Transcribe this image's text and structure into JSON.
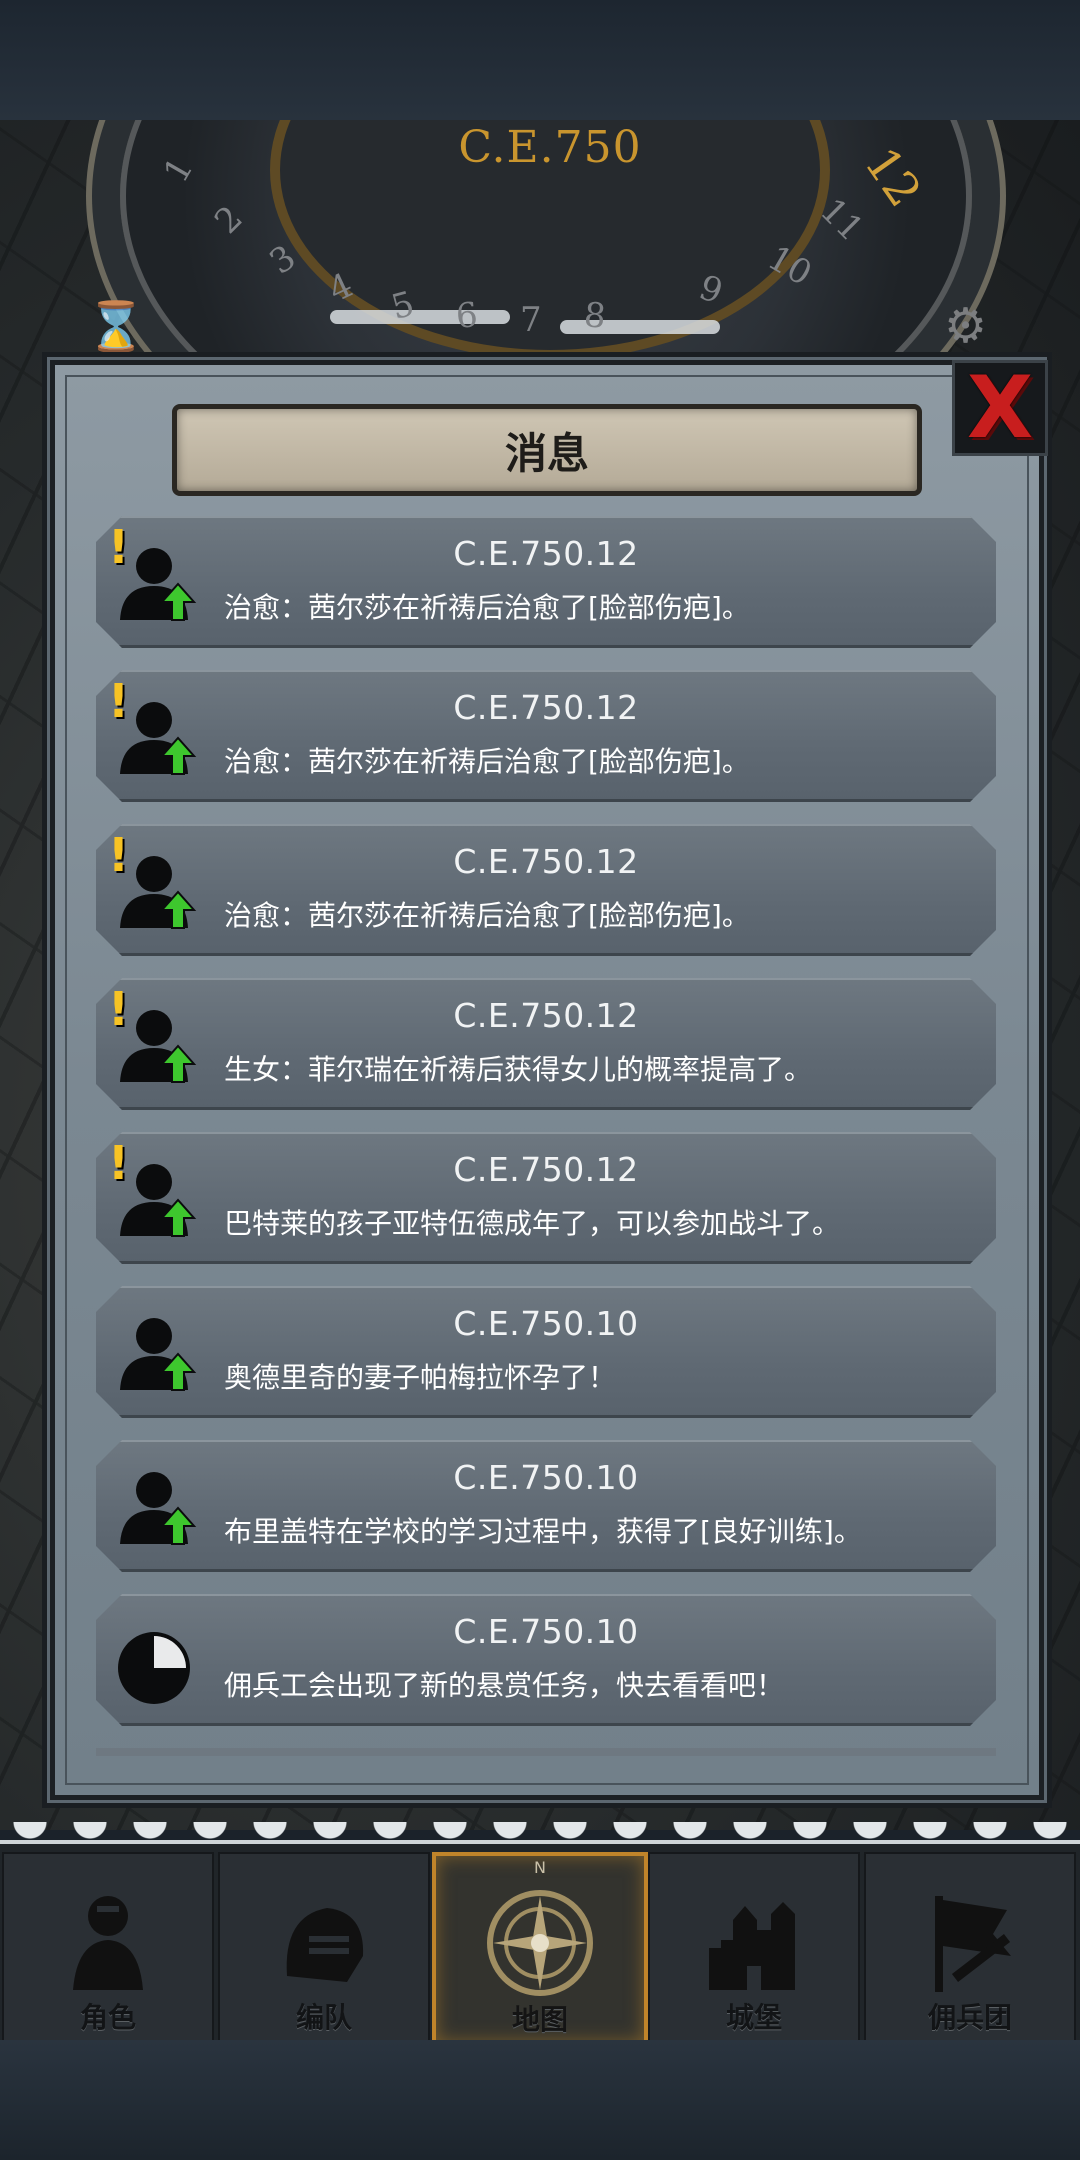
{
  "header": {
    "year": "C.E.750",
    "wheel_numbers": [
      "1",
      "2",
      "3",
      "4",
      "5",
      "6",
      "7",
      "8",
      "9",
      "10",
      "11",
      "12"
    ],
    "current_month": "12"
  },
  "dialog": {
    "title": "消息",
    "close_label": "X",
    "messages": [
      {
        "date": "C.E.750.12",
        "text": "治愈：茜尔莎在祈祷后治愈了[脸部伤疤]。",
        "icon": "person-up-icon",
        "alert": "!"
      },
      {
        "date": "C.E.750.12",
        "text": "治愈：茜尔莎在祈祷后治愈了[脸部伤疤]。",
        "icon": "person-up-icon",
        "alert": "!"
      },
      {
        "date": "C.E.750.12",
        "text": "治愈：茜尔莎在祈祷后治愈了[脸部伤疤]。",
        "icon": "person-up-icon",
        "alert": "!"
      },
      {
        "date": "C.E.750.12",
        "text": "生女：菲尔瑞在祈祷后获得女儿的概率提高了。",
        "icon": "person-up-icon",
        "alert": "!"
      },
      {
        "date": "C.E.750.12",
        "text": "巴特莱的孩子亚特伍德成年了，可以参加战斗了。",
        "icon": "person-up-icon",
        "alert": "!"
      },
      {
        "date": "C.E.750.10",
        "text": "奥德里奇的妻子帕梅拉怀孕了！",
        "icon": "person-up-icon",
        "alert": ""
      },
      {
        "date": "C.E.750.10",
        "text": "布里盖特在学校的学习过程中，获得了[良好训练]。",
        "icon": "person-up-icon",
        "alert": ""
      },
      {
        "date": "C.E.750.10",
        "text": "佣兵工会出现了新的悬赏任务，快去看看吧！",
        "icon": "clock-icon",
        "alert": ""
      }
    ]
  },
  "nav": {
    "compass_letter": "N",
    "items": [
      {
        "label": "角色",
        "icon": "knight-icon",
        "active": false
      },
      {
        "label": "编队",
        "icon": "helmet-icon",
        "active": false
      },
      {
        "label": "地图",
        "icon": "compass-icon",
        "active": true
      },
      {
        "label": "城堡",
        "icon": "castle-icon",
        "active": false
      },
      {
        "label": "佣兵团",
        "icon": "banner-icon",
        "active": false
      }
    ]
  },
  "colors": {
    "accent_gold": "#c9952e",
    "close_red": "#c81e1e",
    "alert_yellow": "#f7c325",
    "arrow_green": "#3ec72e"
  }
}
